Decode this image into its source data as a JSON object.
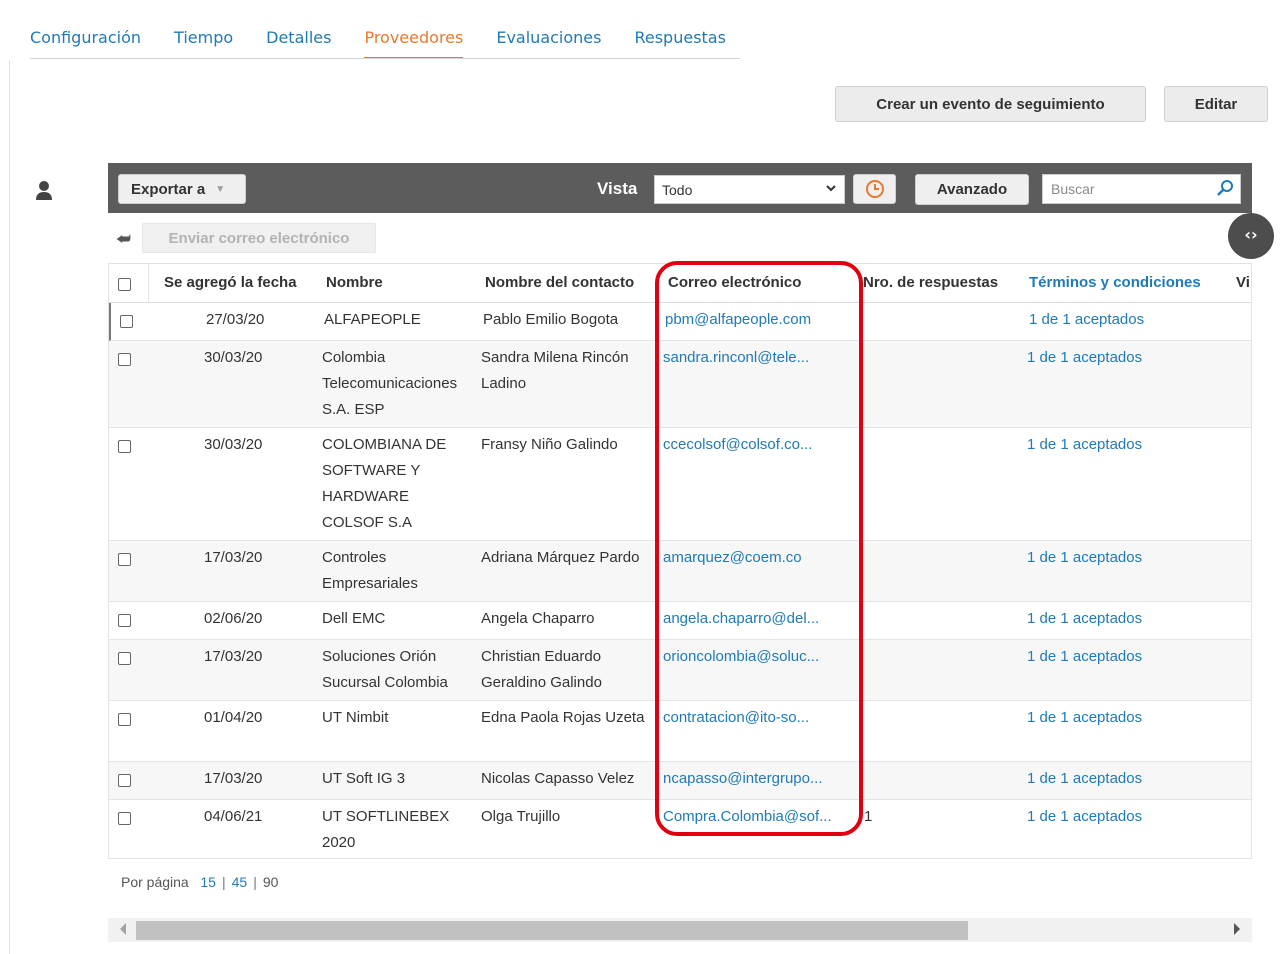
{
  "tabs": [
    {
      "label": "Configuración"
    },
    {
      "label": "Tiempo"
    },
    {
      "label": "Detalles"
    },
    {
      "label": "Proveedores"
    },
    {
      "label": "Evaluaciones"
    },
    {
      "label": "Respuestas"
    }
  ],
  "active_tab": "Proveedores",
  "actions": {
    "follow_up": "Crear un evento de seguimiento",
    "edit": "Editar"
  },
  "toolbar": {
    "export_label": "Exportar a",
    "view_label": "Vista",
    "view_value": "Todo",
    "advanced_label": "Avanzado",
    "search_placeholder": "Buscar",
    "send_email_label": "Enviar correo electrónico"
  },
  "table": {
    "columns": [
      "Se agregó la fecha",
      "Nombre",
      "Nombre del contacto",
      "Correo electrónico",
      "Nro. de respuestas",
      "Términos y condiciones",
      "Vi"
    ],
    "rows": [
      {
        "date": "27/03/20",
        "name": "ALFAPEOPLE",
        "contact": "Pablo Emilio Bogota",
        "email": "pbm@alfapeople.com",
        "responses": "",
        "terms": "1 de 1 aceptados"
      },
      {
        "date": "30/03/20",
        "name": "Colombia Telecomunicaciones S.A. ESP",
        "contact": "Sandra Milena Rincón Ladino",
        "email": "sandra.rinconl@tele...",
        "responses": "",
        "terms": "1 de 1 aceptados"
      },
      {
        "date": "30/03/20",
        "name": "COLOMBIANA DE SOFTWARE Y HARDWARE COLSOF S.A",
        "contact": "Fransy Niño Galindo",
        "email": "ccecolsof@colsof.co...",
        "responses": "",
        "terms": "1 de 1 aceptados"
      },
      {
        "date": "17/03/20",
        "name": "Controles Empresariales",
        "contact": "Adriana Márquez Pardo",
        "email": "amarquez@coem.co",
        "responses": "",
        "terms": "1 de 1 aceptados"
      },
      {
        "date": "02/06/20",
        "name": "Dell EMC",
        "contact": "Angela Chaparro",
        "email": "angela.chaparro@del...",
        "responses": "",
        "terms": "1 de 1 aceptados"
      },
      {
        "date": "17/03/20",
        "name": "Soluciones Orión Sucursal Colombia",
        "contact": "Christian Eduardo Geraldino Galindo",
        "email": "orioncolombia@soluc...",
        "responses": "",
        "terms": "1 de 1 aceptados"
      },
      {
        "date": "01/04/20",
        "name": "UT Nimbit",
        "contact": "Edna Paola Rojas Uzeta",
        "email": "contratacion@ito-so...",
        "responses": "",
        "terms": "1 de 1 aceptados"
      },
      {
        "date": "17/03/20",
        "name": "UT Soft IG 3",
        "contact": "Nicolas Capasso Velez",
        "email": "ncapasso@intergrupo...",
        "responses": "",
        "terms": "1 de 1 aceptados"
      },
      {
        "date": "04/06/21",
        "name": "UT SOFTLINEBEX 2020",
        "contact": "Olga Trujillo",
        "email": "Compra.Colombia@sof...",
        "responses": "1",
        "terms": "1 de 1 aceptados"
      }
    ]
  },
  "pagination": {
    "label": "Por página",
    "options": [
      "15",
      "45",
      "90"
    ]
  },
  "colors": {
    "link": "#1f7ab8",
    "active_tab": "#e8792e",
    "toolbar": "#5c5c5c",
    "highlight": "#e0000f"
  }
}
